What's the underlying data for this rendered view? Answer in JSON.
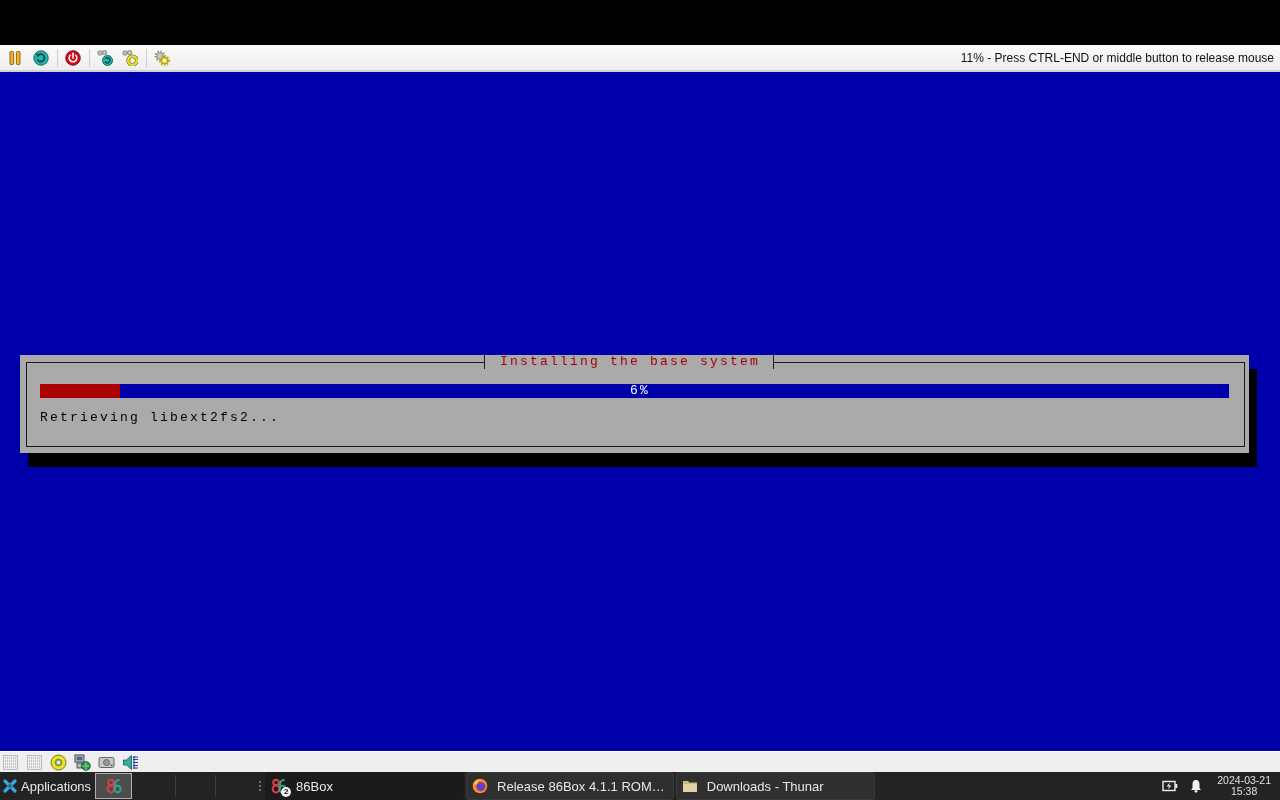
{
  "toolbar": {
    "status_message": "11% - Press CTRL-END or middle button to release mouse"
  },
  "installer": {
    "title": "Installing the base system",
    "progress": {
      "level": 0.067,
      "label": "6%"
    },
    "message": "Retrieving libext2fs2..."
  },
  "taskbar": {
    "menu_label": "Applications",
    "tasks": [
      {
        "kind": "emulator",
        "label": "86Box",
        "badge": "2",
        "selected": true
      },
      {
        "kind": "browser",
        "label": "Release 86Box 4.1.1 ROM…",
        "selected": false
      },
      {
        "kind": "file-manager",
        "label": "Downloads - Thunar",
        "selected": false
      }
    ],
    "clock": {
      "date": "2024-03-21",
      "time": "15:38"
    }
  }
}
